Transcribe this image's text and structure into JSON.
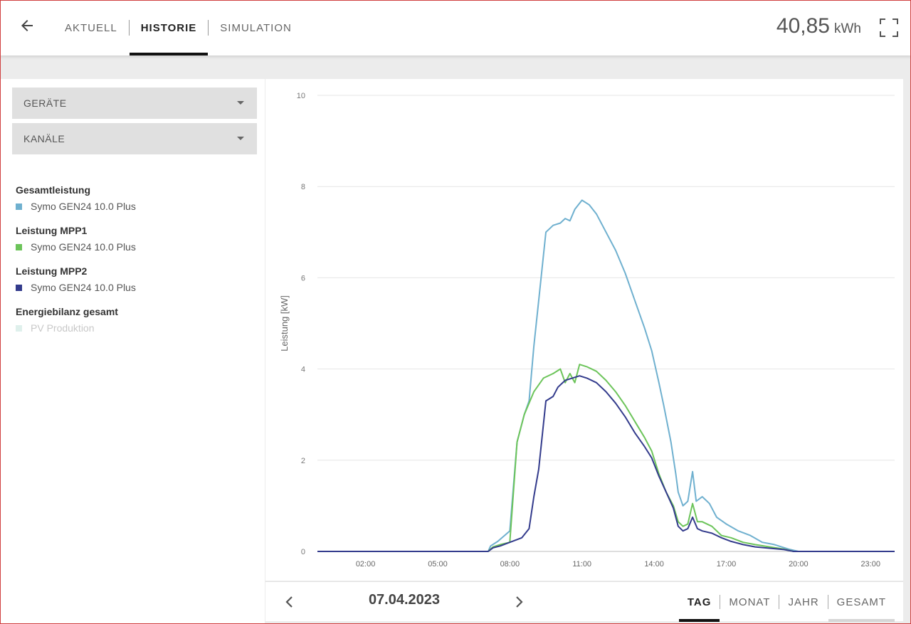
{
  "header": {
    "tabs": [
      {
        "label": "AKTUELL"
      },
      {
        "label": "HISTORIE"
      },
      {
        "label": "SIMULATION"
      }
    ],
    "energy_value": "40,85",
    "energy_unit": "kWh"
  },
  "sidebar": {
    "dropdown_devices": "GERÄTE",
    "dropdown_channels": "KANÄLE",
    "legend": [
      {
        "title": "Gesamtleistung",
        "item": "Symo GEN24 10.0 Plus",
        "color": "#6fb0cf"
      },
      {
        "title": "Leistung MPP1",
        "item": "Symo GEN24 10.0 Plus",
        "color": "#6cc45a"
      },
      {
        "title": "Leistung MPP2",
        "item": "Symo GEN24 10.0 Plus",
        "color": "#333b8c"
      },
      {
        "title": "Energiebilanz gesamt",
        "item": "PV Produktion",
        "color": "#dff0ec"
      }
    ]
  },
  "footer": {
    "date": "07.04.2023",
    "periods": [
      "TAG",
      "MONAT",
      "JAHR",
      "GESAMT"
    ]
  },
  "chart_data": {
    "type": "line",
    "ylabel": "Leistung [kW]",
    "ylim": [
      0,
      10
    ],
    "yticks": [
      "0",
      "2",
      "4",
      "6",
      "8",
      "10"
    ],
    "xlim": [
      0,
      24
    ],
    "xticks": [
      {
        "h": 2,
        "label": "02:00"
      },
      {
        "h": 5,
        "label": "05:00"
      },
      {
        "h": 8,
        "label": "08:00"
      },
      {
        "h": 11,
        "label": "11:00"
      },
      {
        "h": 14,
        "label": "14:00"
      },
      {
        "h": 17,
        "label": "17:00"
      },
      {
        "h": 20,
        "label": "20:00"
      },
      {
        "h": 23,
        "label": "23:00"
      }
    ],
    "series": [
      {
        "name": "Gesamtleistung",
        "color": "#6fb0cf",
        "points": [
          [
            0,
            0
          ],
          [
            7.1,
            0
          ],
          [
            7.2,
            0.12
          ],
          [
            7.5,
            0.22
          ],
          [
            8.0,
            0.45
          ],
          [
            8.3,
            2.4
          ],
          [
            8.6,
            3.0
          ],
          [
            8.8,
            3.3
          ],
          [
            9.0,
            4.5
          ],
          [
            9.2,
            5.5
          ],
          [
            9.5,
            7.0
          ],
          [
            9.8,
            7.15
          ],
          [
            10.1,
            7.2
          ],
          [
            10.3,
            7.3
          ],
          [
            10.5,
            7.25
          ],
          [
            10.7,
            7.5
          ],
          [
            11.0,
            7.7
          ],
          [
            11.3,
            7.6
          ],
          [
            11.6,
            7.4
          ],
          [
            12.0,
            7.0
          ],
          [
            12.4,
            6.6
          ],
          [
            12.8,
            6.1
          ],
          [
            13.2,
            5.5
          ],
          [
            13.6,
            4.9
          ],
          [
            13.9,
            4.4
          ],
          [
            14.2,
            3.7
          ],
          [
            14.4,
            3.2
          ],
          [
            14.7,
            2.4
          ],
          [
            14.9,
            1.7
          ],
          [
            15.0,
            1.3
          ],
          [
            15.2,
            1.0
          ],
          [
            15.4,
            1.1
          ],
          [
            15.6,
            1.75
          ],
          [
            15.75,
            1.1
          ],
          [
            16.0,
            1.2
          ],
          [
            16.3,
            1.05
          ],
          [
            16.6,
            0.75
          ],
          [
            17.0,
            0.6
          ],
          [
            17.5,
            0.45
          ],
          [
            18.0,
            0.35
          ],
          [
            18.5,
            0.2
          ],
          [
            19.0,
            0.15
          ],
          [
            19.6,
            0.05
          ],
          [
            20.0,
            0
          ],
          [
            24,
            0
          ]
        ]
      },
      {
        "name": "Leistung MPP1",
        "color": "#6cc45a",
        "points": [
          [
            0,
            0
          ],
          [
            7.1,
            0
          ],
          [
            7.3,
            0.1
          ],
          [
            7.6,
            0.15
          ],
          [
            8.0,
            0.2
          ],
          [
            8.3,
            2.4
          ],
          [
            8.6,
            3.0
          ],
          [
            9.0,
            3.5
          ],
          [
            9.4,
            3.8
          ],
          [
            9.8,
            3.9
          ],
          [
            10.1,
            4.0
          ],
          [
            10.3,
            3.7
          ],
          [
            10.5,
            3.9
          ],
          [
            10.7,
            3.7
          ],
          [
            10.9,
            4.1
          ],
          [
            11.2,
            4.05
          ],
          [
            11.6,
            3.95
          ],
          [
            12.0,
            3.75
          ],
          [
            12.4,
            3.5
          ],
          [
            12.8,
            3.2
          ],
          [
            13.2,
            2.85
          ],
          [
            13.6,
            2.5
          ],
          [
            13.9,
            2.2
          ],
          [
            14.2,
            1.7
          ],
          [
            14.5,
            1.3
          ],
          [
            14.8,
            1.0
          ],
          [
            15.0,
            0.65
          ],
          [
            15.2,
            0.55
          ],
          [
            15.4,
            0.6
          ],
          [
            15.6,
            1.05
          ],
          [
            15.8,
            0.65
          ],
          [
            16.0,
            0.65
          ],
          [
            16.4,
            0.55
          ],
          [
            16.8,
            0.35
          ],
          [
            17.2,
            0.3
          ],
          [
            17.7,
            0.2
          ],
          [
            18.2,
            0.15
          ],
          [
            18.8,
            0.1
          ],
          [
            19.4,
            0.05
          ],
          [
            19.8,
            0
          ],
          [
            24,
            0
          ]
        ]
      },
      {
        "name": "Leistung MPP2",
        "color": "#333b8c",
        "points": [
          [
            0,
            0
          ],
          [
            7.1,
            0
          ],
          [
            7.3,
            0.08
          ],
          [
            7.6,
            0.12
          ],
          [
            8.0,
            0.2
          ],
          [
            8.5,
            0.3
          ],
          [
            8.8,
            0.5
          ],
          [
            9.0,
            1.2
          ],
          [
            9.2,
            1.8
          ],
          [
            9.5,
            3.3
          ],
          [
            9.8,
            3.4
          ],
          [
            10.0,
            3.6
          ],
          [
            10.3,
            3.75
          ],
          [
            10.6,
            3.8
          ],
          [
            10.9,
            3.85
          ],
          [
            11.2,
            3.8
          ],
          [
            11.6,
            3.7
          ],
          [
            12.0,
            3.5
          ],
          [
            12.4,
            3.25
          ],
          [
            12.8,
            2.95
          ],
          [
            13.2,
            2.6
          ],
          [
            13.6,
            2.3
          ],
          [
            13.9,
            2.05
          ],
          [
            14.2,
            1.65
          ],
          [
            14.5,
            1.3
          ],
          [
            14.8,
            0.95
          ],
          [
            15.0,
            0.55
          ],
          [
            15.2,
            0.45
          ],
          [
            15.4,
            0.5
          ],
          [
            15.6,
            0.75
          ],
          [
            15.8,
            0.5
          ],
          [
            16.0,
            0.45
          ],
          [
            16.4,
            0.4
          ],
          [
            16.8,
            0.3
          ],
          [
            17.2,
            0.22
          ],
          [
            17.7,
            0.15
          ],
          [
            18.2,
            0.1
          ],
          [
            18.8,
            0.07
          ],
          [
            19.4,
            0.04
          ],
          [
            19.8,
            0
          ],
          [
            24,
            0
          ]
        ]
      }
    ]
  }
}
